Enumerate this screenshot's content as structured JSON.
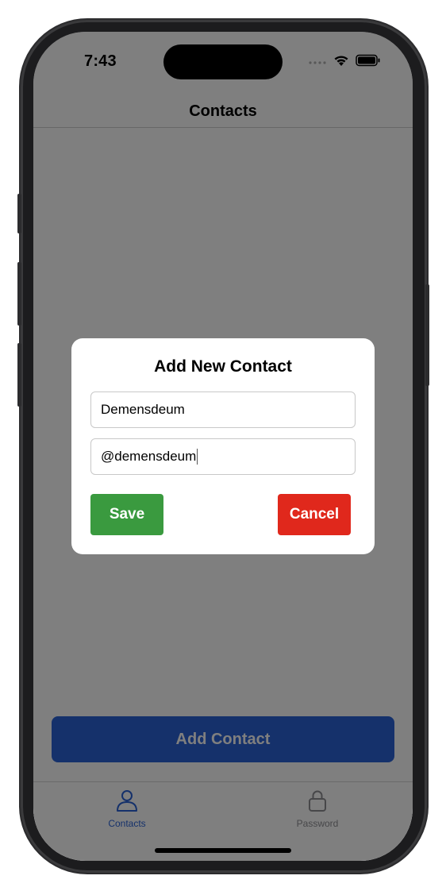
{
  "status_bar": {
    "time": "7:43"
  },
  "header": {
    "title": "Contacts"
  },
  "modal": {
    "title": "Add New Contact",
    "name_value": "Demensdeum",
    "handle_value": "@demensdeum",
    "save_label": "Save",
    "cancel_label": "Cancel",
    "save_color": "#3a9a3f",
    "cancel_color": "#e0281c"
  },
  "main": {
    "add_contact_label": "Add Contact",
    "button_color": "#2b63d6"
  },
  "tab_bar": {
    "tabs": [
      {
        "label": "Contacts",
        "icon": "person-icon",
        "active": true
      },
      {
        "label": "Password",
        "icon": "lock-icon",
        "active": false
      }
    ],
    "active_color": "#2b63d6",
    "inactive_color": "#8e8e93"
  }
}
